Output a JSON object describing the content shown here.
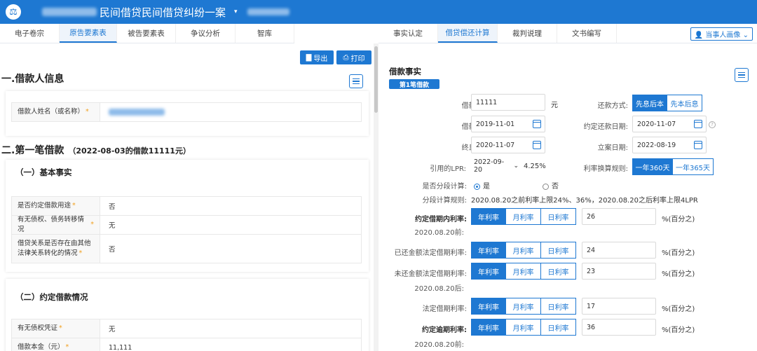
{
  "header": {
    "title": "民间借贷民间借贷纠纷一案",
    "caret": "▾"
  },
  "left_tabs": [
    {
      "label": "电子卷宗",
      "active": false
    },
    {
      "label": "原告要素表",
      "active": true
    },
    {
      "label": "被告要素表",
      "active": false
    },
    {
      "label": "争议分析",
      "active": false
    },
    {
      "label": "智库",
      "active": false
    }
  ],
  "right_tabs": [
    {
      "label": "事实认定",
      "active": false
    },
    {
      "label": "借贷偿还计算",
      "active": true
    },
    {
      "label": "裁判说理",
      "active": false
    },
    {
      "label": "文书编写",
      "active": false
    }
  ],
  "user_portrait_label": "当事人画像",
  "toolbar": {
    "export_label": "导出",
    "print_label": "打印"
  },
  "left": {
    "section1": {
      "title": "一.借款人信息",
      "field_label": "借款人姓名（或名称）"
    },
    "section2": {
      "title": "二.第一笔借款",
      "subtitle": "（2022-08-03的借款11111元）"
    },
    "basic": {
      "title": "（一）基本事实",
      "rows": [
        {
          "label": "是否约定借款用途",
          "value": "否"
        },
        {
          "label": "有无债权、债务转移情况",
          "value": "无"
        },
        {
          "label": "借贷关系是否存在由其他法律关系转化的情况",
          "value": "否"
        }
      ]
    },
    "agreed": {
      "title": "（二）约定借款情况",
      "rows": [
        {
          "label": "有无债权凭证",
          "value": "无"
        },
        {
          "label": "借款本金（元）",
          "value": "11,111"
        }
      ]
    },
    "required_mark": "*"
  },
  "right": {
    "section_title": "借款事实",
    "badge": "第1笔借款",
    "loan_amount": {
      "label": "借款金额:",
      "value": "11111",
      "unit": "元"
    },
    "repay_method": {
      "label": "还款方式:",
      "options": [
        "先息后本",
        "先本后息"
      ],
      "selected": 0
    },
    "loan_date": {
      "label": "借款日期:",
      "value": "2019-11-01"
    },
    "agreed_repay_date": {
      "label": "约定还款日期:",
      "value": "2020-11-07"
    },
    "interest_end_date": {
      "label": "终息日期:",
      "value": "2020-11-07"
    },
    "filing_date": {
      "label": "立案日期:",
      "value": "2022-08-19"
    },
    "lpr": {
      "label": "引用的LPR:",
      "value": "2022-09-20",
      "rate": "4.25%"
    },
    "rate_rule": {
      "label": "利率换算规则:",
      "options": [
        "一年360天",
        "一年365天"
      ],
      "selected": 0
    },
    "segmented": {
      "label": "是否分段计算:",
      "yes": "是",
      "no": "否",
      "selected": "yes"
    },
    "segment_rule": {
      "label": "分段计算规则:",
      "text": "2020.08.20之前利率上限24%、36%，2020.08.20之后利率上限4LPR"
    },
    "rate_type_options": [
      "年利率",
      "月利率",
      "日利率"
    ],
    "percent_unit": "%(百分之)",
    "rates": [
      {
        "label": "约定借期内利率:",
        "sublabel": "2020.08.20前:",
        "value": "26",
        "bold": true
      },
      {
        "label": "已还金额法定借期利率:",
        "sublabel": "",
        "value": "24",
        "bold": false
      },
      {
        "label": "未还金额法定借期利率:",
        "sublabel": "2020.08.20后:",
        "value": "23",
        "bold": false
      },
      {
        "label": "法定借期利率:",
        "sublabel": "",
        "value": "17",
        "bold": false
      },
      {
        "label": "约定逾期利率:",
        "sublabel": "2020.08.20前:",
        "value": "36",
        "bold": true
      }
    ]
  }
}
